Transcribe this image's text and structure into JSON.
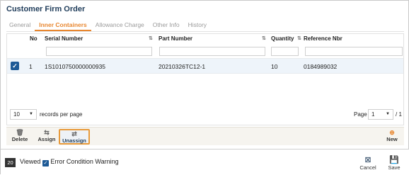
{
  "window": {
    "title": "Customer Firm Order"
  },
  "tabs": [
    {
      "label": "General",
      "active": false
    },
    {
      "label": "Inner Containers",
      "active": true
    },
    {
      "label": "Allowance Charge",
      "active": false
    },
    {
      "label": "Other Info",
      "active": false
    },
    {
      "label": "History",
      "active": false
    }
  ],
  "grid": {
    "columns": {
      "no": "No",
      "serial": "Serial Number",
      "part": "Part Number",
      "qty": "Quantity",
      "ref": "Reference Nbr"
    },
    "rows": [
      {
        "checked": true,
        "no": "1",
        "serial": "1S1010750000000935",
        "part": "20210326TC12-1",
        "qty": "10",
        "ref": "0184989032"
      }
    ]
  },
  "pager": {
    "page_size": "10",
    "records_label": "records per page",
    "page_label": "Page",
    "page_value": "1",
    "total_label": "/ 1"
  },
  "actions": {
    "delete": "Delete",
    "assign": "Assign",
    "unassign": "Unassign",
    "new": "New"
  },
  "footer": {
    "count": "20",
    "viewed_label": "Viewed",
    "warning_label": "Error Condition Warning",
    "cancel": "Cancel",
    "save": "Save"
  },
  "colors": {
    "accent": "#e8862e",
    "primary": "#1e5a96",
    "title": "#1f3c5a"
  }
}
